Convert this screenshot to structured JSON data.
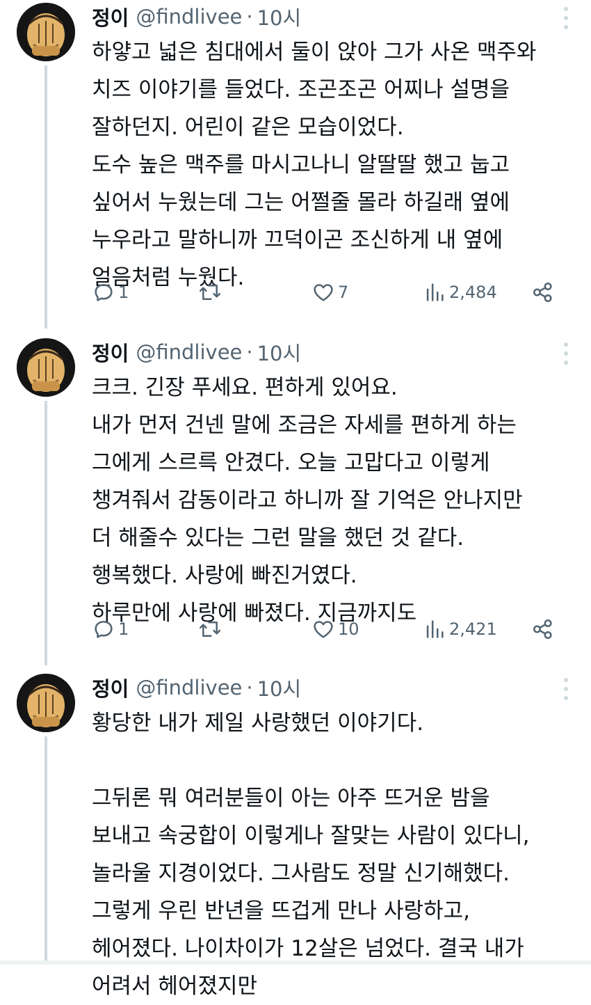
{
  "tweets": [
    {
      "name": "정이",
      "handle": "@findlivee",
      "separator": "·",
      "time": "10시",
      "lines": [
        "하얗고 넓은 침대에서 둘이 앉아 그가 사온 맥주와",
        "치즈 이야기를 들었다. 조곤조곤 어찌나 설명을",
        "잘하던지. 어린이 같은 모습이었다.",
        "도수 높은 맥주를 마시고나니 알딸딸 했고 눕고",
        "싶어서 누웠는데 그는 어쩔줄 몰라 하길래 옆에",
        "누우라고 말하니까 끄덕이곤 조신하게 내 옆에",
        "얼음처럼 누웠다."
      ],
      "replies": "1",
      "retweets": "",
      "likes": "7",
      "views": "2,484"
    },
    {
      "name": "정이",
      "handle": "@findlivee",
      "separator": "·",
      "time": "10시",
      "lines": [
        "크크. 긴장 푸세요. 편하게 있어요.",
        "내가 먼저 건넨 말에 조금은 자세를 편하게 하는",
        "그에게 스르륵 안겼다. 오늘 고맙다고 이렇게",
        "챙겨줘서 감동이라고 하니까 잘 기억은 안나지만",
        "더 해줄수 있다는 그런 말을 했던 것 같다.",
        "행복했다. 사랑에 빠진거였다.",
        "하루만에 사랑에 빠졌다. 지금까지도"
      ],
      "replies": "1",
      "retweets": "",
      "likes": "10",
      "views": "2,421"
    },
    {
      "name": "정이",
      "handle": "@findlivee",
      "separator": "·",
      "time": "10시",
      "lines": [
        "황당한 내가 제일 사랑했던 이야기다.",
        "",
        "그뒤론 뭐 여러분들이 아는 아주 뜨거운 밤을",
        "보내고 속궁합이 이렇게나 잘맞는 사람이 있다니,",
        "놀라울 지경이었다. 그사람도 정말 신기해했다.",
        "그렇게 우린 반년을 뜨겁게 만나 사랑하고,",
        "헤어졌다. 나이차이가 12살은 넘었다. 결국 내가",
        "어려서 헤어졌지만"
      ]
    }
  ],
  "icons": {
    "reply": "reply-icon",
    "retweet": "retweet-icon",
    "like": "heart-icon",
    "views": "views-icon",
    "share": "share-icon",
    "more": "more-icon",
    "avatar": "avatar-image"
  },
  "colors": {
    "text": "#0f1419",
    "secondary": "#536471",
    "thread_line": "#cfd9de",
    "avatar_bg": "#151515",
    "avatar_face": "#e2b368"
  }
}
